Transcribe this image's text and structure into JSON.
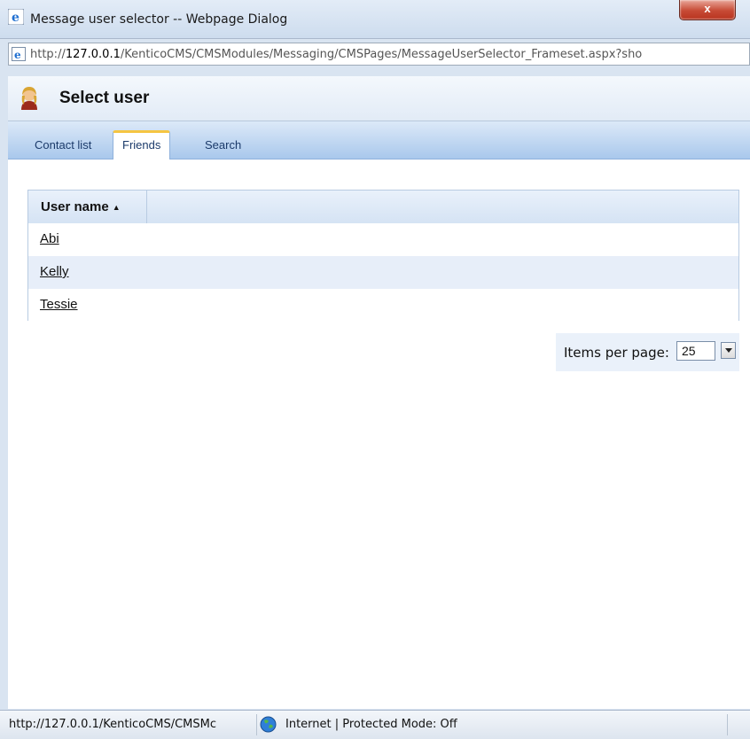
{
  "window": {
    "title": "Message user selector -- Webpage Dialog",
    "close_label": "x",
    "url": "http://127.0.0.1/KenticoCMS/CMSModules/Messaging/CMSPages/MessageUserSelector_Frameset.aspx?sho",
    "url_host": "127.0.0.1",
    "url_prefix": "http://",
    "url_rest": "/KenticoCMS/CMSModules/Messaging/CMSPages/MessageUserSelector_Frameset.aspx?sho"
  },
  "header": {
    "title": "Select user",
    "icon": "user-icon"
  },
  "tabs": [
    {
      "label": "Contact list",
      "active": false
    },
    {
      "label": "Friends",
      "active": true
    },
    {
      "label": "Search",
      "active": false
    }
  ],
  "grid": {
    "column_header": "User name",
    "sort_indicator": "▲",
    "rows": [
      "Abi",
      "Kelly",
      "Tessie"
    ]
  },
  "pager": {
    "label": "Items per page:",
    "value": "25"
  },
  "status": {
    "url": "http://127.0.0.1/KenticoCMS/CMSMc",
    "zone": "Internet | Protected Mode: Off"
  },
  "colors": {
    "alt_row": "#e7eef9",
    "accent_tab": "#f5c542"
  }
}
